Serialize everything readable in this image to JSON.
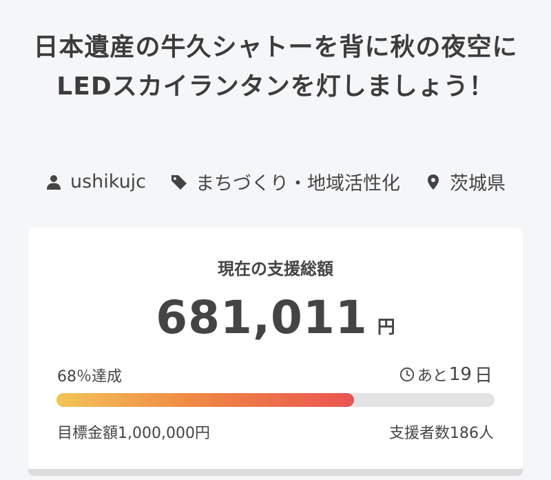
{
  "title": "日本遺産の牛久シャトーを背に秋の夜空にLEDスカイランタンを灯しましょう！",
  "meta": {
    "user": "ushikujc",
    "category": "まちづくり・地域活性化",
    "location": "茨城県"
  },
  "funding": {
    "label": "現在の支援総額",
    "amount": "681,011",
    "unit": "円",
    "percent_text": "68％達成",
    "progress_fraction": 0.68,
    "remaining_prefix": "あと",
    "remaining_days": "19",
    "remaining_unit": "日",
    "goal_text": "目標金額1,000,000円",
    "backers_text": "支援者数186人"
  },
  "colors": {
    "background": "#f5f6f8",
    "card": "#ffffff",
    "progress_start": "#f3c358",
    "progress_end": "#ea5450",
    "track": "#e3e3e3"
  },
  "icons": [
    "user-icon",
    "tag-icon",
    "location-pin-icon",
    "clock-icon"
  ]
}
